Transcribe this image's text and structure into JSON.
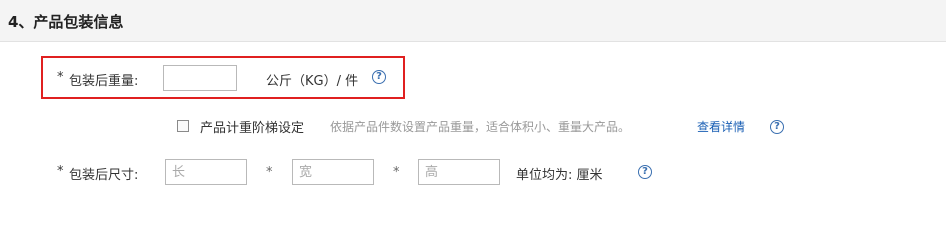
{
  "section": {
    "title": "4、产品包装信息"
  },
  "weight_row": {
    "required_mark": "*",
    "label": "包装后重量:",
    "input_value": "",
    "unit": "公斤（KG）/ 件",
    "help": "?"
  },
  "tier_row": {
    "checkbox_label": "产品计重阶梯设定",
    "checked": false,
    "description": "依据产品件数设置产品重量，适合体积小、重量大产品。",
    "link": "查看详情",
    "help": "?"
  },
  "size_row": {
    "required_mark": "*",
    "label": "包装后尺寸:",
    "length_placeholder": "长",
    "width_placeholder": "宽",
    "height_placeholder": "高",
    "multiply1": "*",
    "multiply2": "*",
    "unit_note": "单位均为: 厘米",
    "help": "?"
  },
  "colors": {
    "required": "#e4393c",
    "highlight_border": "#e02020",
    "link": "#1a5fb4",
    "header_bg": "#f4f4f4"
  }
}
